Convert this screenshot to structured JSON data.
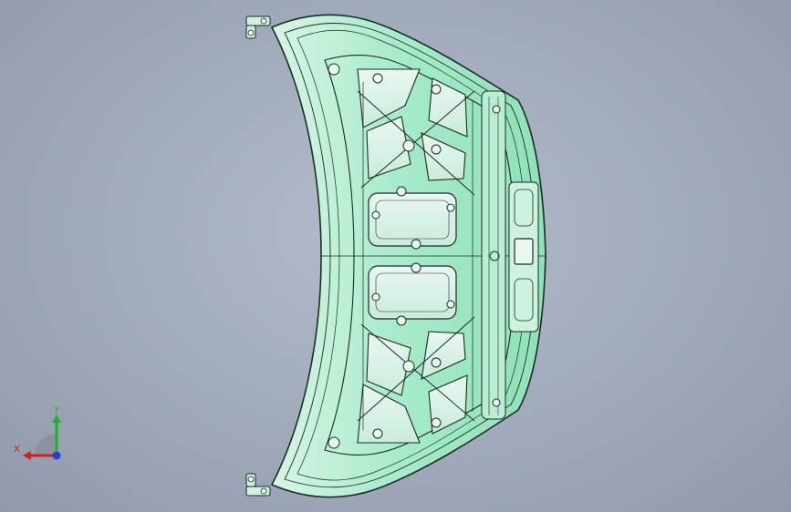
{
  "viewport": {
    "colors": {
      "background_center": "#b4bccb",
      "background_edge": "#9199ab",
      "part_face": "#9fe8c4",
      "part_face_light": "#d7f5e6",
      "part_edge": "#1d2a24",
      "axis_x": "#d42020",
      "axis_y": "#1fb02e",
      "axis_z": "#1f3fd8"
    },
    "model": {
      "name": "hood-inner-panel",
      "icon": "hood-part-icon"
    },
    "triad": {
      "x_label": "X",
      "y_label": "Y"
    }
  }
}
